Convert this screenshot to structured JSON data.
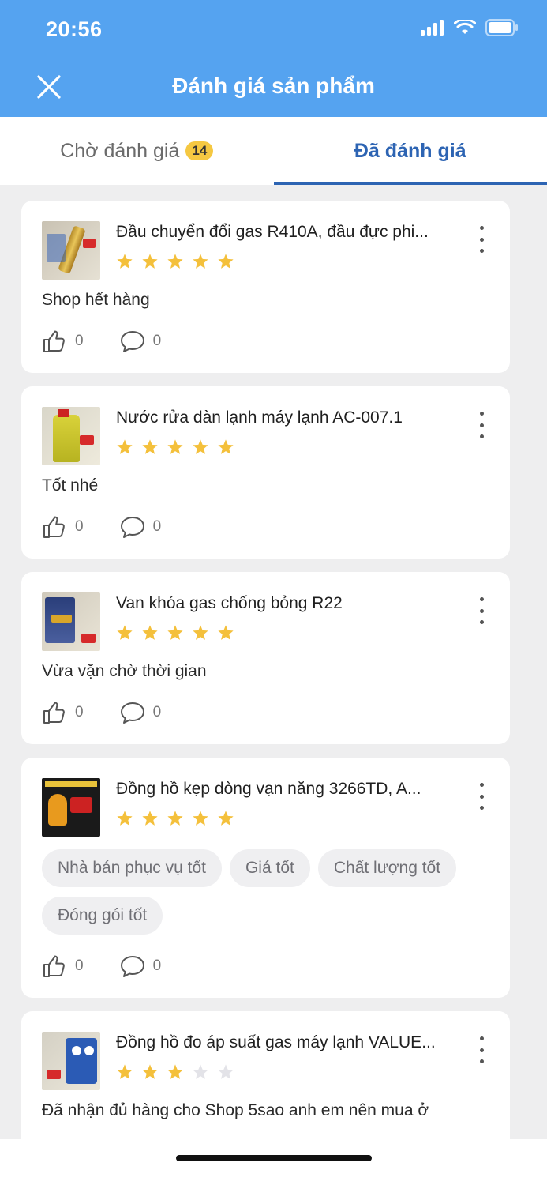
{
  "status_bar": {
    "time": "20:56"
  },
  "header": {
    "title": "Đánh giá sản phẩm",
    "close_icon": "close-icon"
  },
  "tabs": [
    {
      "label": "Chờ đánh giá",
      "badge": "14"
    },
    {
      "label": "Đã đánh giá"
    }
  ],
  "colors": {
    "header": "#55a3f0",
    "accent": "#2d64b3",
    "star": "#f4c03b",
    "star_empty": "#e3e3e8"
  },
  "reviews": [
    {
      "product": "Đầu chuyển đổi gas R410A, đầu đực phi...",
      "rating": 5,
      "comment": "Shop hết hàng",
      "likes": "0",
      "comments": "0"
    },
    {
      "product": "Nước rửa dàn lạnh máy lạnh AC-007.1",
      "rating": 5,
      "comment": "Tốt nhé",
      "likes": "0",
      "comments": "0"
    },
    {
      "product": "Van khóa gas chống bỏng R22",
      "rating": 5,
      "comment": "Vừa vặn chờ thời gian",
      "likes": "0",
      "comments": "0"
    },
    {
      "product": "Đồng hồ kẹp dòng vạn năng 3266TD, A...",
      "rating": 5,
      "tags": [
        "Nhà bán phục vụ tốt",
        "Giá tốt",
        "Chất lượng tốt",
        "Đóng gói tốt"
      ],
      "likes": "0",
      "comments": "0"
    },
    {
      "product": "Đồng hồ đo áp suất gas máy lạnh VALUE...",
      "rating": 3,
      "comment": "Đã nhận đủ hàng cho Shop 5sao anh em nên mua ở"
    }
  ]
}
